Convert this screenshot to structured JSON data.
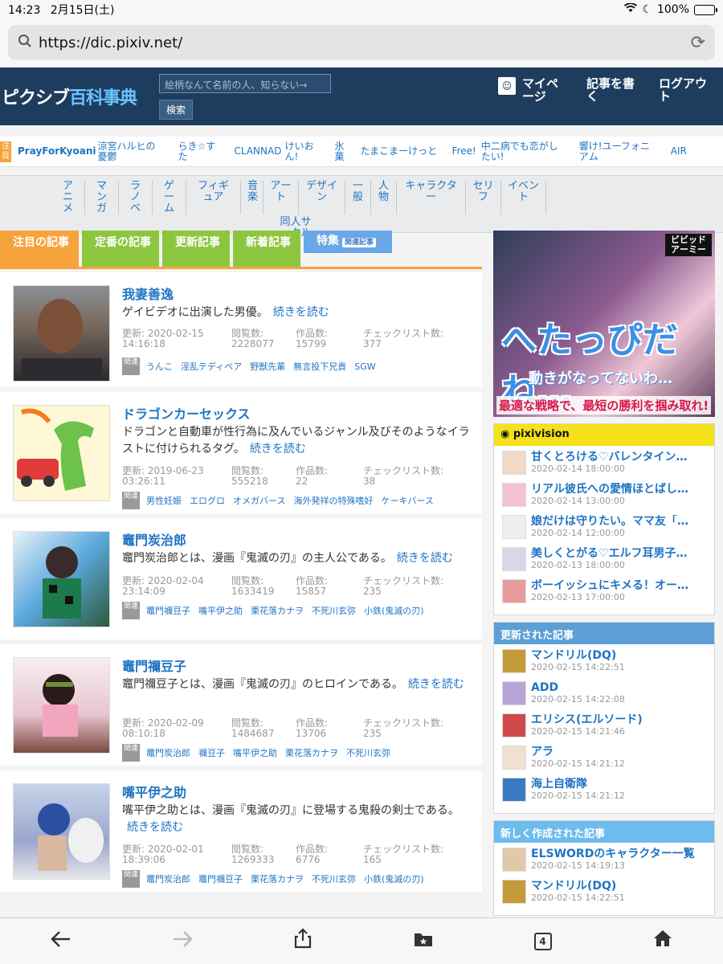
{
  "status": {
    "time": "14:23",
    "date": "2月15日(土)",
    "battery": "100%"
  },
  "urlbar": {
    "url": "https://dic.pixiv.net/"
  },
  "header": {
    "logo_main": "ピクシブ",
    "logo_accent": "百科事典",
    "search_placeholder": "絵柄なんて名前の人、知らない→",
    "search_button": "検索",
    "mypage": "マイページ",
    "write": "記事を書く",
    "logout": "ログアウト"
  },
  "trend": {
    "tag": "注目",
    "items": [
      "PrayForKyoani",
      "涼宮ハルヒの憂鬱",
      "らき☆すた",
      "CLANNAD",
      "けいおん!",
      "氷菓",
      "たまこまーけっと",
      "Free!",
      "中二病でも恋がしたい!",
      "響け!ユーフォニアム",
      "AIR"
    ]
  },
  "categories": [
    "アニメ",
    "マンガ",
    "ラノベ",
    "ゲーム",
    "フィギュア",
    "音楽",
    "アート",
    "デザイン",
    "一般",
    "人物",
    "キャラクター",
    "セリフ",
    "イベント",
    "同人サークル"
  ],
  "tabs": {
    "featured": "注目の記事",
    "standard": "定番の記事",
    "updated": "更新記事",
    "new": "新着記事",
    "special": "特集",
    "special_badge": "関連記事"
  },
  "labels": {
    "more": "続きを読む",
    "updated": "更新:",
    "views": "閲覧数:",
    "works": "作品数:",
    "checklist": "チェックリスト数:",
    "related": "関連"
  },
  "articles": [
    {
      "title": "我妻善逸",
      "desc": "ゲイビデオに出演した男優。",
      "date": "2020-02-15",
      "time": "14:16:18",
      "views": "2228077",
      "works": "15799",
      "checklist": "377",
      "related": [
        "うんこ",
        "淫乱テディベア",
        "野獣先輩",
        "無言投下兄貴",
        "SGW"
      ]
    },
    {
      "title": "ドラゴンカーセックス",
      "desc": "ドラゴンと自動車が性行為に及んでいるジャンル及びそのようなイラストに付けられるタグ。",
      "date": "2019-06-23",
      "time": "03:26:11",
      "views": "555218",
      "works": "22",
      "checklist": "38",
      "related": [
        "男性妊娠",
        "エログロ",
        "オメガバース",
        "海外発祥の特殊嗜好",
        "ケーキバース"
      ]
    },
    {
      "title": "竈門炭治郎",
      "desc": "竈門炭治郎とは、漫画『鬼滅の刃』の主人公である。",
      "date": "2020-02-04",
      "time": "23:14:09",
      "views": "1633419",
      "works": "15857",
      "checklist": "235",
      "related": [
        "竈門禰豆子",
        "嘴平伊之助",
        "栗花落カナヲ",
        "不死川玄弥",
        "小鉄(鬼滅の刃)"
      ]
    },
    {
      "title": "竈門禰豆子",
      "desc": "竈門禰豆子とは、漫画『鬼滅の刃』のヒロインである。",
      "date": "2020-02-09",
      "time": "08:10:18",
      "views": "1484687",
      "works": "13706",
      "checklist": "235",
      "related": [
        "竈門炭治郎",
        "禰豆子",
        "嘴平伊之助",
        "栗花落カナヲ",
        "不死川玄弥"
      ]
    },
    {
      "title": "嘴平伊之助",
      "desc": "嘴平伊之助とは、漫画『鬼滅の刃』に登場する鬼殺の剣士である。",
      "date": "2020-02-01",
      "time": "18:39:06",
      "views": "1269333",
      "works": "6776",
      "checklist": "165",
      "related": [
        "竈門炭治郎",
        "竈門禰豆子",
        "栗花落カナヲ",
        "不死川玄弥",
        "小鉄(鬼滅の刃)"
      ]
    }
  ],
  "ad": {
    "brand": "ビビッドアーミー",
    "big": "へたっぴだね…",
    "mid": "動きがなってないわ…",
    "low": "最適な戦略で、最短の勝利を掴み取れ!"
  },
  "pixivision": {
    "head": "pixivision",
    "items": [
      {
        "title": "甘くとろける♡バレンタイン…",
        "date": "2020-02-14 18:00:00"
      },
      {
        "title": "リアル彼氏への愛情ほとばし…",
        "date": "2020-02-14 13:00:00"
      },
      {
        "title": "娘だけは守りたい。ママ友「…",
        "date": "2020-02-14 12:00:00"
      },
      {
        "title": "美しくとがる♡エルフ耳男子…",
        "date": "2020-02-13 18:00:00"
      },
      {
        "title": "ボーイッシュにキメる！オー…",
        "date": "2020-02-13 17:00:00"
      }
    ]
  },
  "updated_box": {
    "head": "更新された記事",
    "items": [
      {
        "title": "マンドリル(DQ)",
        "date": "2020-02-15 14:22:51"
      },
      {
        "title": "ADD",
        "date": "2020-02-15 14:22:08"
      },
      {
        "title": "エリシス(エルソード)",
        "date": "2020-02-15 14:21:46"
      },
      {
        "title": "アラ",
        "date": "2020-02-15 14:21:12"
      },
      {
        "title": "海上自衛隊",
        "date": "2020-02-15 14:21:12"
      }
    ]
  },
  "new_box": {
    "head": "新しく作成された記事",
    "items": [
      {
        "title": "ELSWORDのキャラクター一覧",
        "date": "2020-02-15 14:19:13"
      },
      {
        "title": "マンドリル(DQ)",
        "date": "2020-02-15 14:22:51"
      }
    ]
  },
  "toolbar": {
    "tab_count": "4"
  },
  "colors": {
    "header": "#1e3d5e",
    "accent_orange": "#f7a33b",
    "accent_green": "#8cc63f",
    "link": "#1f74c4"
  }
}
